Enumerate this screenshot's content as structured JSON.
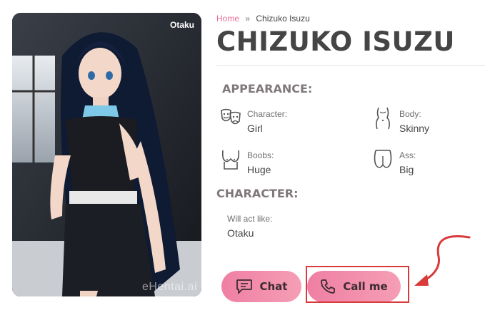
{
  "portrait": {
    "badge": "Otaku",
    "watermark": "eHentai.ai"
  },
  "breadcrumb": {
    "home": "Home",
    "separator": "»",
    "current": "Chizuko Isuzu"
  },
  "title": "CHIZUKO ISUZU",
  "appearance": {
    "heading": "APPEARANCE:",
    "items": [
      {
        "label": "Character:",
        "value": "Girl",
        "icon": "masks-icon"
      },
      {
        "label": "Body:",
        "value": "Skinny",
        "icon": "body-icon"
      },
      {
        "label": "Boobs:",
        "value": "Huge",
        "icon": "boobs-icon"
      },
      {
        "label": "Ass:",
        "value": "Big",
        "icon": "ass-icon"
      }
    ]
  },
  "character": {
    "heading": "CHARACTER:",
    "label": "Will act like:",
    "value": "Otaku"
  },
  "buttons": {
    "chat": "Chat",
    "call": "Call me"
  },
  "colors": {
    "accent": "#ec6a96",
    "button_gradient_start": "#ef7fa4",
    "button_gradient_end": "#f59eb5",
    "highlight": "#d93a3a"
  }
}
